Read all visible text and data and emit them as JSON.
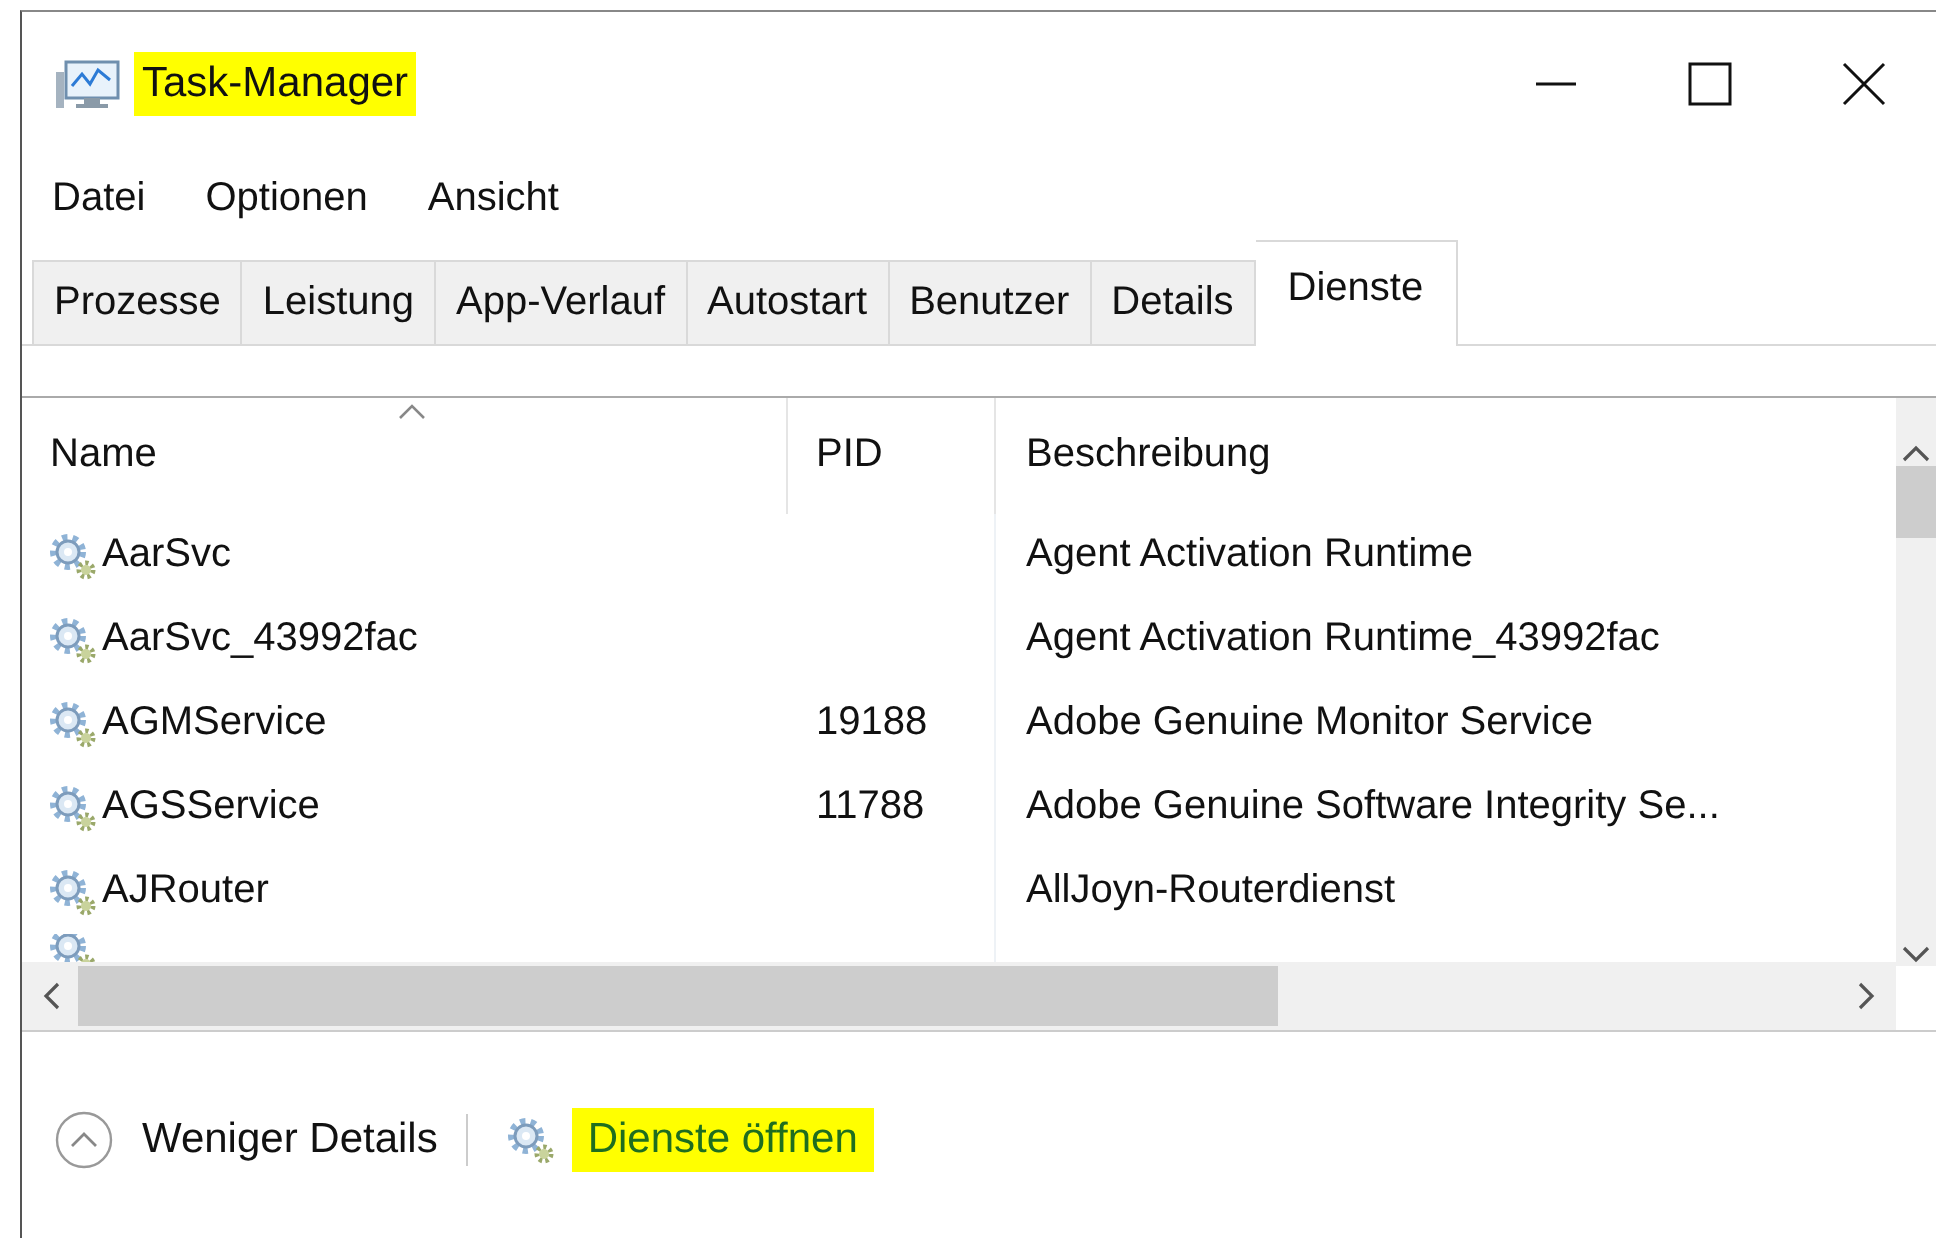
{
  "window": {
    "title": "Task-Manager",
    "title_highlighted": true
  },
  "menu": [
    "Datei",
    "Optionen",
    "Ansicht"
  ],
  "tabs": [
    {
      "label": "Prozesse",
      "selected": false
    },
    {
      "label": "Leistung",
      "selected": false
    },
    {
      "label": "App-Verlauf",
      "selected": false
    },
    {
      "label": "Autostart",
      "selected": false
    },
    {
      "label": "Benutzer",
      "selected": false
    },
    {
      "label": "Details",
      "selected": false
    },
    {
      "label": "Dienste",
      "selected": true
    }
  ],
  "table": {
    "columns": [
      {
        "label": "Name",
        "sorted": true
      },
      {
        "label": "PID",
        "sorted": false
      },
      {
        "label": "Beschreibung",
        "sorted": false
      }
    ],
    "rows": [
      {
        "name": "AarSvc",
        "description": "Agent Activation Runtime"
      },
      {
        "name": "AarSvc_43992fac",
        "description": "Agent Activation Runtime_43992fac"
      },
      {
        "name": "AGMService",
        "pid": "19188",
        "description": "Adobe Genuine Monitor Service"
      },
      {
        "name": "AGSService",
        "pid": "11788",
        "description": "Adobe Genuine Software Integrity Se..."
      },
      {
        "name": "AJRouter",
        "description": "AllJoyn-Routerdienst"
      }
    ]
  },
  "footer": {
    "less_details": "Weniger Details",
    "open_services": "Dienste öffnen",
    "open_services_highlighted": true
  }
}
